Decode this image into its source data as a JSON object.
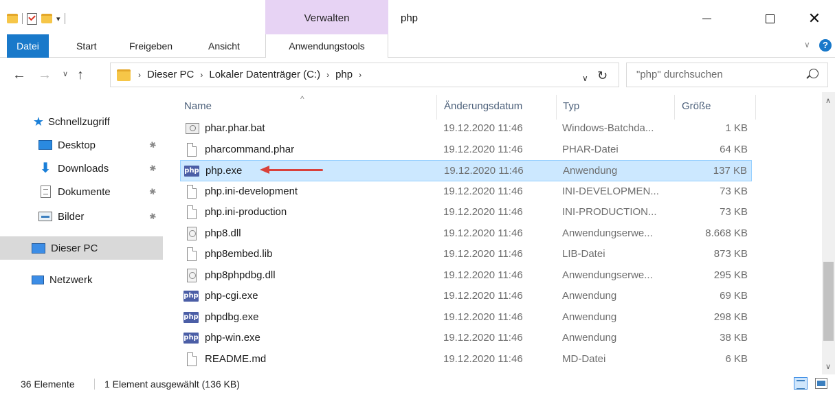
{
  "window": {
    "title": "php",
    "context_tab": "Verwalten"
  },
  "ribbon": {
    "tabs": [
      "Datei",
      "Start",
      "Freigeben",
      "Ansicht",
      "Anwendungstools"
    ]
  },
  "address": {
    "crumbs": [
      "Dieser PC",
      "Lokaler Datenträger (C:)",
      "php"
    ],
    "search_placeholder": "\"php\" durchsuchen"
  },
  "navpane": {
    "items": [
      {
        "label": "Schnellzugriff",
        "icon": "star-icon"
      },
      {
        "label": "Desktop",
        "icon": "desktop-icon",
        "pinned": true
      },
      {
        "label": "Downloads",
        "icon": "download-icon",
        "pinned": true
      },
      {
        "label": "Dokumente",
        "icon": "documents-icon",
        "pinned": true
      },
      {
        "label": "Bilder",
        "icon": "pictures-icon",
        "pinned": true
      },
      {
        "label": "Dieser PC",
        "icon": "computer-icon",
        "selected": true
      },
      {
        "label": "Netzwerk",
        "icon": "network-icon"
      }
    ]
  },
  "columns": {
    "name": "Name",
    "date": "Änderungsdatum",
    "type": "Typ",
    "size": "Größe"
  },
  "files": [
    {
      "name": "phar.phar.bat",
      "date": "19.12.2020 11:46",
      "type": "Windows-Batchda...",
      "size": "1 KB",
      "icon": "batch-file-icon"
    },
    {
      "name": "pharcommand.phar",
      "date": "19.12.2020 11:46",
      "type": "PHAR-Datei",
      "size": "64 KB",
      "icon": "file-icon"
    },
    {
      "name": "php.exe",
      "date": "19.12.2020 11:46",
      "type": "Anwendung",
      "size": "137 KB",
      "icon": "php-icon",
      "selected": true
    },
    {
      "name": "php.ini-development",
      "date": "19.12.2020 11:46",
      "type": "INI-DEVELOPMEN...",
      "size": "73 KB",
      "icon": "file-icon"
    },
    {
      "name": "php.ini-production",
      "date": "19.12.2020 11:46",
      "type": "INI-PRODUCTION...",
      "size": "73 KB",
      "icon": "file-icon"
    },
    {
      "name": "php8.dll",
      "date": "19.12.2020 11:46",
      "type": "Anwendungserwe...",
      "size": "8.668 KB",
      "icon": "dll-icon"
    },
    {
      "name": "php8embed.lib",
      "date": "19.12.2020 11:46",
      "type": "LIB-Datei",
      "size": "873 KB",
      "icon": "file-icon"
    },
    {
      "name": "php8phpdbg.dll",
      "date": "19.12.2020 11:46",
      "type": "Anwendungserwe...",
      "size": "295 KB",
      "icon": "dll-icon"
    },
    {
      "name": "php-cgi.exe",
      "date": "19.12.2020 11:46",
      "type": "Anwendung",
      "size": "69 KB",
      "icon": "php-icon"
    },
    {
      "name": "phpdbg.exe",
      "date": "19.12.2020 11:46",
      "type": "Anwendung",
      "size": "298 KB",
      "icon": "php-icon"
    },
    {
      "name": "php-win.exe",
      "date": "19.12.2020 11:46",
      "type": "Anwendung",
      "size": "38 KB",
      "icon": "php-icon"
    },
    {
      "name": "README.md",
      "date": "19.12.2020 11:46",
      "type": "MD-Datei",
      "size": "6 KB",
      "icon": "file-icon"
    }
  ],
  "php_icon_glyph": "php",
  "status": {
    "count": "36 Elemente",
    "selection": "1 Element ausgewählt (136 KB)"
  },
  "colors": {
    "accent": "#1979ca",
    "manage_tab": "#e7d3f4",
    "selection": "#cce8ff",
    "arrow": "#d9413a"
  }
}
